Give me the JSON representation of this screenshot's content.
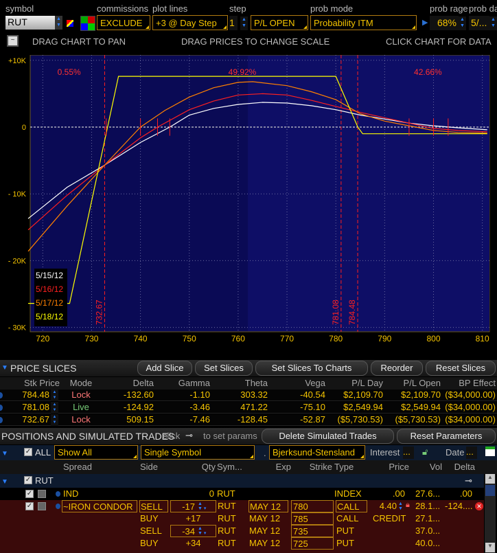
{
  "toolbar": {
    "symbol_label": "symbol",
    "symbol_value": "RUT",
    "commissions_label": "commissions",
    "commissions_value": "EXCLUDE",
    "plot_lines_label": "plot lines",
    "plot_lines_value": "+3 @ Day Step",
    "step_label": "step",
    "step_value": "1",
    "pl_mode_value": "P/L OPEN",
    "prob_mode_label": "prob mode",
    "prob_mode_value": "Probability ITM",
    "prob_range_label": "prob rage",
    "prob_range_value": "68%",
    "prob_date_label": "prob da",
    "prob_date_value": "5/..."
  },
  "hints": {
    "pan": "DRAG CHART TO PAN",
    "scale": "DRAG PRICES TO CHANGE SCALE",
    "data": "CLICK CHART FOR DATA"
  },
  "chart_data": {
    "type": "line",
    "xlim": [
      717,
      811
    ],
    "ylim": [
      -30000,
      10000
    ],
    "x_ticks": [
      "720",
      "730",
      "740",
      "750",
      "760",
      "770",
      "780",
      "790",
      "800",
      "810"
    ],
    "y_ticks": [
      {
        "v": 10000,
        "label": "+10K"
      },
      {
        "v": 0,
        "label": "0"
      },
      {
        "v": -10000,
        "label": "- 10K"
      },
      {
        "v": -20000,
        "label": "- 20K"
      },
      {
        "v": -30000,
        "label": "- 30K"
      }
    ],
    "grid": true,
    "legend_position": "bottom-left",
    "series": [
      {
        "name": "5/15/12",
        "color": "#ffffff",
        "x": [
          717,
          725,
          732.67,
          740,
          746,
          750,
          755,
          760,
          765,
          770,
          775,
          780,
          785,
          790,
          795,
          800,
          805,
          811
        ],
        "y": [
          -13700,
          -9000,
          -5700,
          -2300,
          0,
          1800,
          2800,
          3400,
          3700,
          3600,
          3200,
          2600,
          1800,
          1200,
          600,
          200,
          -100,
          -400
        ]
      },
      {
        "name": "5/16/12",
        "color": "#ff2020",
        "x": [
          717,
          725,
          732.67,
          740,
          743.5,
          750,
          755,
          760,
          765,
          770,
          775,
          780,
          785,
          790,
          795,
          800,
          805,
          811
        ],
        "y": [
          -15400,
          -10200,
          -5700,
          -1600,
          0,
          2600,
          3900,
          4800,
          5000,
          4800,
          4000,
          3100,
          2200,
          1400,
          600,
          -200,
          -500,
          -700
        ]
      },
      {
        "name": "5/17/12",
        "color": "#ff8000",
        "x": [
          717,
          725,
          732.67,
          740,
          745,
          750,
          755,
          760,
          763,
          770,
          775,
          780,
          785,
          790,
          795,
          800,
          805,
          811
        ],
        "y": [
          -18600,
          -11800,
          -5700,
          0,
          2500,
          4500,
          5900,
          6700,
          6800,
          6200,
          5300,
          4100,
          2000,
          900,
          200,
          -500,
          -800,
          -900
        ]
      },
      {
        "name": "5/18/12",
        "color": "#ffff00",
        "x": [
          717,
          725.5,
          735.5,
          780,
          784.5,
          785.5,
          811
        ],
        "y": [
          -26400,
          -26400,
          7600,
          7600,
          0,
          -1000,
          -1000
        ]
      }
    ],
    "slice_lines": [
      {
        "x": 732.67,
        "label": "732.67"
      },
      {
        "x": 781.08,
        "label": "781.08"
      },
      {
        "x": 784.48,
        "label": "784.48"
      }
    ],
    "zone_probabilities": [
      {
        "x": 723,
        "label": "0.55%"
      },
      {
        "x": 758,
        "label": "49.92%"
      },
      {
        "x": 796,
        "label": "42.66%"
      }
    ],
    "colors": {
      "background": "#0a0a55",
      "grid": "#6a6aa0",
      "axis_text": "#f5c400",
      "slice": "#ff2020"
    }
  },
  "price_slices": {
    "title": "PRICE SLICES",
    "buttons": [
      "Add Slice",
      "Set Slices",
      "Set Slices To Charts",
      "Reorder",
      "Reset Slices"
    ],
    "columns": [
      "Stk Price",
      "Mode",
      "Delta",
      "Gamma",
      "Theta",
      "Vega",
      "P/L Day",
      "P/L Open",
      "BP Effect"
    ],
    "rows": [
      {
        "price": "784.48",
        "mode": "Lock",
        "delta": "-132.60",
        "gamma": "-1.10",
        "theta": "303.32",
        "vega": "-40.54",
        "pl_day": "$2,109.70",
        "pl_open": "$2,109.70",
        "bp": "($34,000.00)"
      },
      {
        "price": "781.08",
        "mode": "Live",
        "delta": "-124.92",
        "gamma": "-3.46",
        "theta": "471.22",
        "vega": "-75.10",
        "pl_day": "$2,549.94",
        "pl_open": "$2,549.94",
        "bp": "($34,000.00)"
      },
      {
        "price": "732.67",
        "mode": "Lock",
        "delta": "509.15",
        "gamma": "-7.46",
        "theta": "-128.45",
        "vega": "-52.87",
        "pl_day": "($5,730.53)",
        "pl_open": "($5,730.53)",
        "bp": "($34,000.00)"
      }
    ]
  },
  "positions": {
    "title": "POSITIONS AND SIMULATED TRADES",
    "hint1": "click",
    "hint2": "to set params",
    "delete_button": "Delete Simulated Trades",
    "reset_button": "Reset Parameters",
    "filter_all": "ALL",
    "filter_show": "Show All",
    "filter_symbol": "Single Symbol",
    "dot": ".",
    "model": "Bjerksund-Stensland",
    "interest_label": "Interest",
    "interest_value": "...",
    "date_label": "Date",
    "date_value": "...",
    "columns": [
      "Spread",
      "Side",
      "Qty",
      "Sym...",
      "Exp",
      "Strike",
      "Type",
      "Price",
      "Vol",
      "Delta"
    ],
    "group": "RUT",
    "ind_row": {
      "spread": "IND",
      "qty": "0",
      "sym": "RUT",
      "type": "INDEX",
      "price": ".00",
      "vol": "27.6...",
      "delta": ".00"
    },
    "condor_price": "4.40",
    "condor_credit": "CREDIT",
    "condor_delta": "-124....",
    "legs": [
      {
        "spread": "~IRON CONDOR",
        "side": "SELL",
        "qty": "-17",
        "sym": "RUT",
        "exp": "MAY 12",
        "strike": "780",
        "type": "CALL",
        "vol": "28.1..."
      },
      {
        "spread": "",
        "side": "BUY",
        "qty": "+17",
        "sym": "RUT",
        "exp": "MAY 12",
        "strike": "785",
        "type": "CALL",
        "vol": "27.1..."
      },
      {
        "spread": "",
        "side": "SELL",
        "qty": "-34",
        "sym": "RUT",
        "exp": "MAY 12",
        "strike": "735",
        "type": "PUT",
        "vol": "37.0..."
      },
      {
        "spread": "",
        "side": "BUY",
        "qty": "+34",
        "sym": "RUT",
        "exp": "MAY 12",
        "strike": "725",
        "type": "PUT",
        "vol": "40.0..."
      }
    ]
  }
}
